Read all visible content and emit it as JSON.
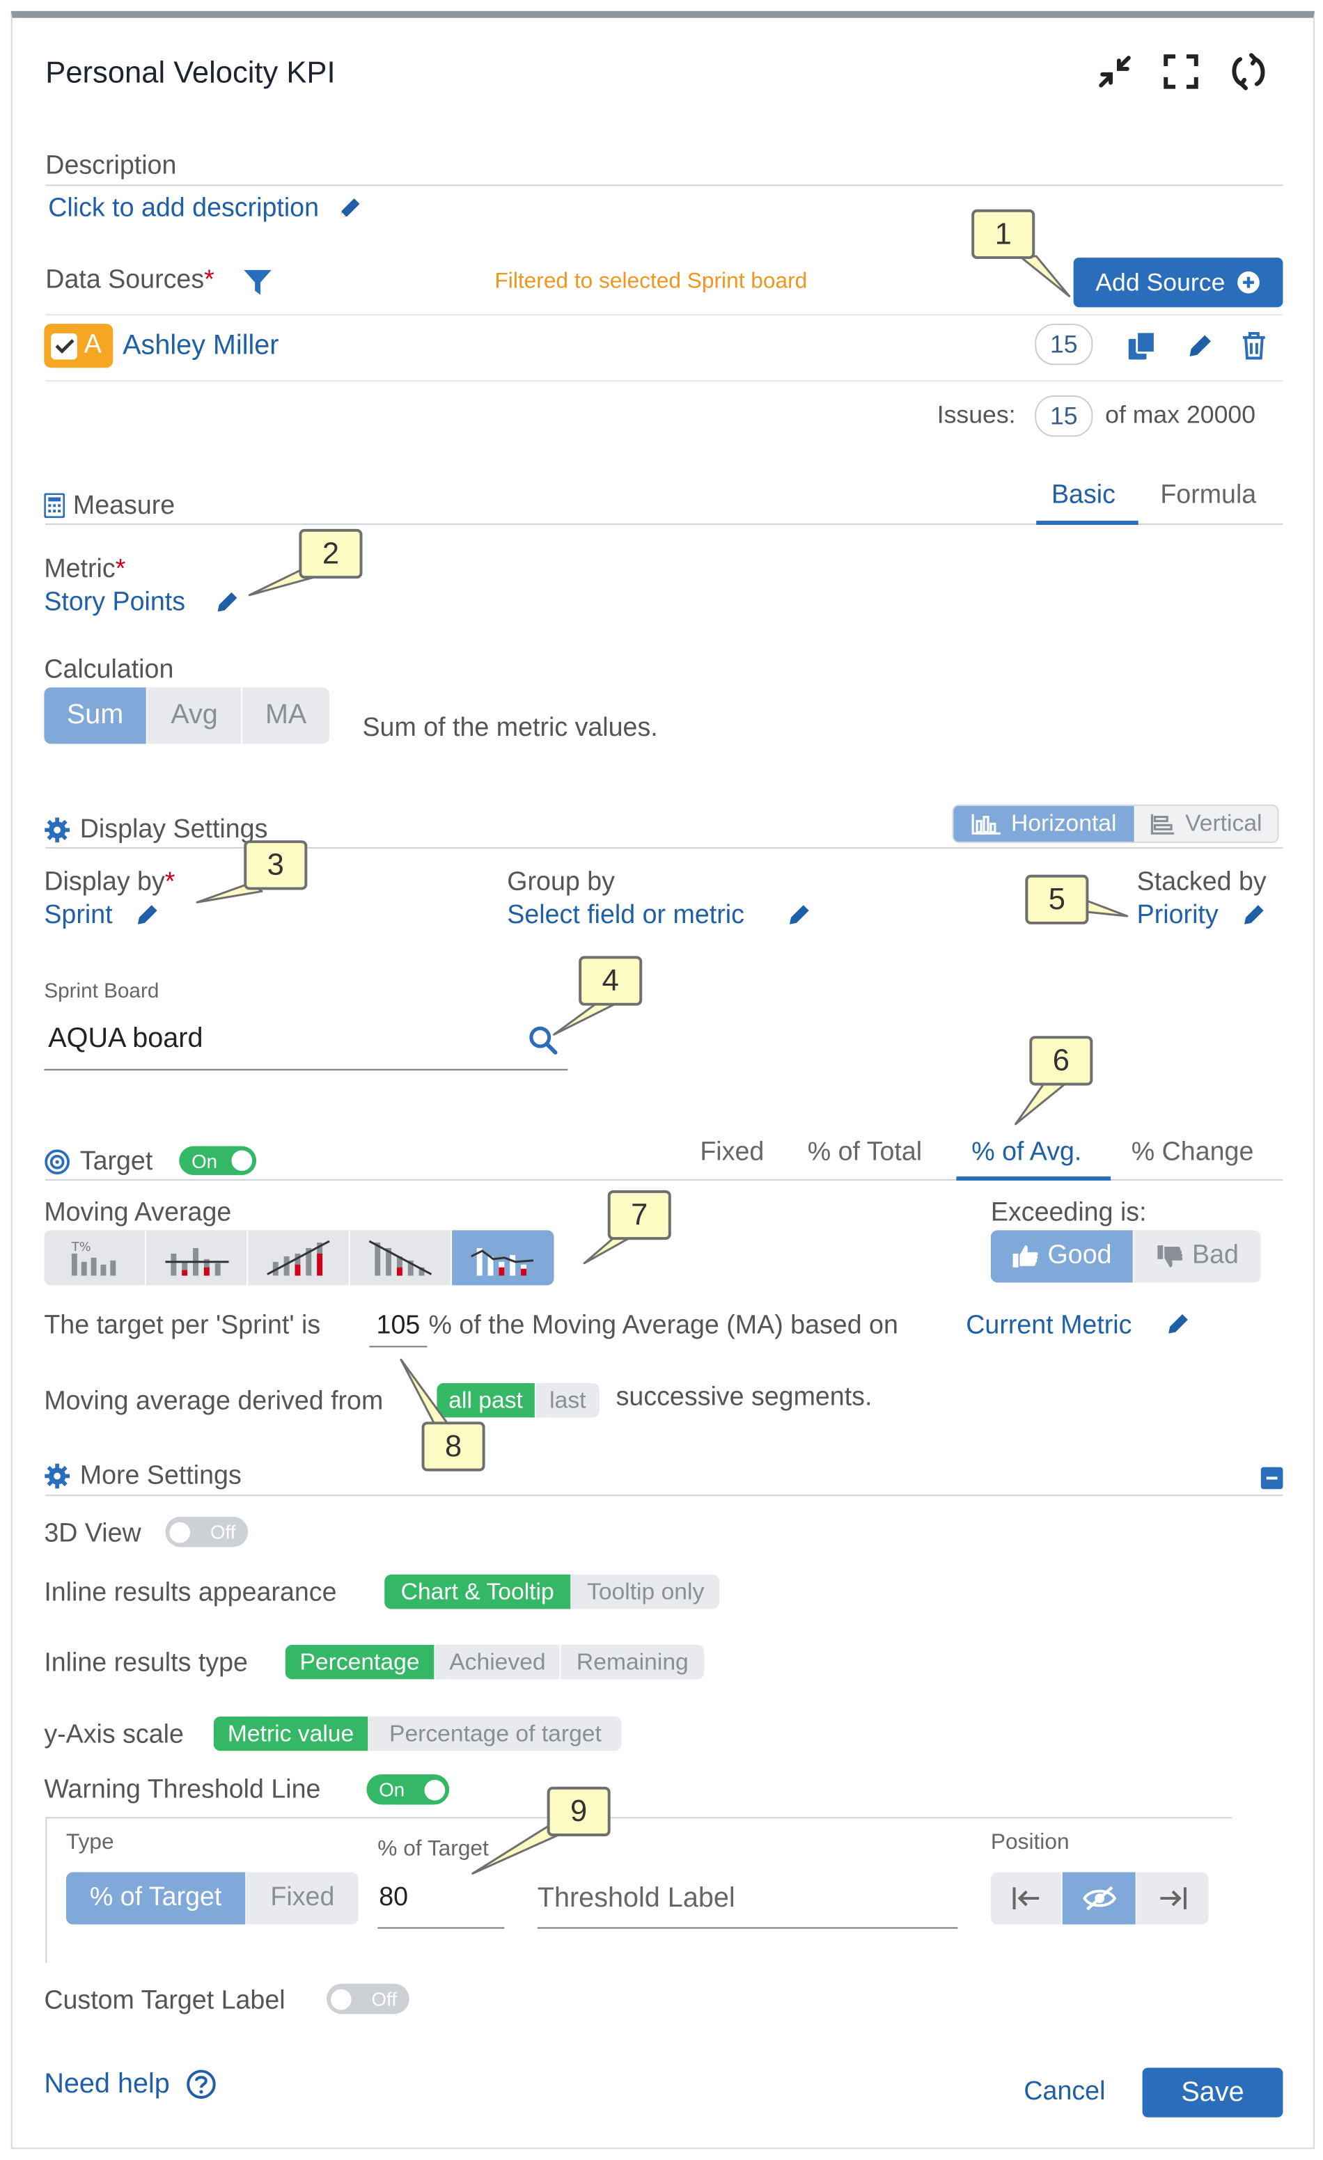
{
  "header": {
    "title": "Personal Velocity KPI"
  },
  "description": {
    "label": "Description",
    "link": "Click to add description"
  },
  "data_sources": {
    "label": "Data Sources",
    "required_mark": "*",
    "filter_note": "Filtered to selected Sprint board",
    "add_button": "Add Source",
    "source": {
      "avatar_letter": "A",
      "name": "Ashley Miller",
      "count": "15"
    },
    "issues_label": "Issues:",
    "issues_count": "15",
    "issues_max": "of max 20000"
  },
  "measure": {
    "label": "Measure",
    "tabs": [
      "Basic",
      "Formula"
    ],
    "metric_label": "Metric",
    "required_mark": "*",
    "metric_value": "Story Points",
    "calculation_label": "Calculation",
    "calc_options": [
      "Sum",
      "Avg",
      "MA"
    ],
    "calc_description": "Sum of the metric values."
  },
  "display": {
    "label": "Display Settings",
    "orientation": [
      "Horizontal",
      "Vertical"
    ],
    "display_by_label": "Display by",
    "required_mark": "*",
    "display_by_value": "Sprint",
    "group_by_label": "Group by",
    "group_by_value": "Select field or metric",
    "stacked_by_label": "Stacked by",
    "stacked_by_value": "Priority",
    "sprint_board_label": "Sprint Board",
    "sprint_board_value": "AQUA board"
  },
  "target": {
    "label": "Target",
    "toggle": "On",
    "tabs": [
      "Fixed",
      "% of Total",
      "% of Avg.",
      "% Change"
    ],
    "moving_average_label": "Moving Average",
    "exceeding_label": "Exceeding is:",
    "exceeding_options": [
      "Good",
      "Bad"
    ],
    "sentence_part1": "The target per 'Sprint' is",
    "target_percent": "105",
    "sentence_part2": "% of the Moving Average (MA) based on",
    "based_on_link": "Current Metric",
    "derived_label": "Moving average derived from",
    "derived_options": [
      "all past",
      "last"
    ],
    "derived_suffix": "successive segments."
  },
  "more_settings": {
    "label": "More Settings",
    "view3d_label": "3D View",
    "view3d_toggle": "Off",
    "inline_appearance_label": "Inline results appearance",
    "inline_appearance_options": [
      "Chart & Tooltip",
      "Tooltip only"
    ],
    "inline_type_label": "Inline results type",
    "inline_type_options": [
      "Percentage",
      "Achieved",
      "Remaining"
    ],
    "yaxis_label": "y-Axis scale",
    "yaxis_options": [
      "Metric value",
      "Percentage of target"
    ],
    "warning_label": "Warning Threshold Line",
    "warning_toggle": "On",
    "threshold": {
      "type_label": "Type",
      "type_options": [
        "% of Target",
        "Fixed"
      ],
      "percent_label": "% of Target",
      "percent_value": "80",
      "label_placeholder": "Threshold Label",
      "position_label": "Position"
    },
    "custom_label": "Custom Target Label",
    "custom_toggle": "Off"
  },
  "footer": {
    "help": "Need help",
    "cancel": "Cancel",
    "save": "Save"
  },
  "callouts": [
    "1",
    "2",
    "3",
    "4",
    "5",
    "6",
    "7",
    "8",
    "9"
  ],
  "colors": {
    "primary": "#2a6ebb",
    "link": "#1f5fa8",
    "selected_blue": "#80a8d8",
    "selected_green": "#35b866",
    "note_orange": "#f0961e",
    "source_badge": "#f5a623",
    "callout_fill": "#fdfbc4"
  }
}
